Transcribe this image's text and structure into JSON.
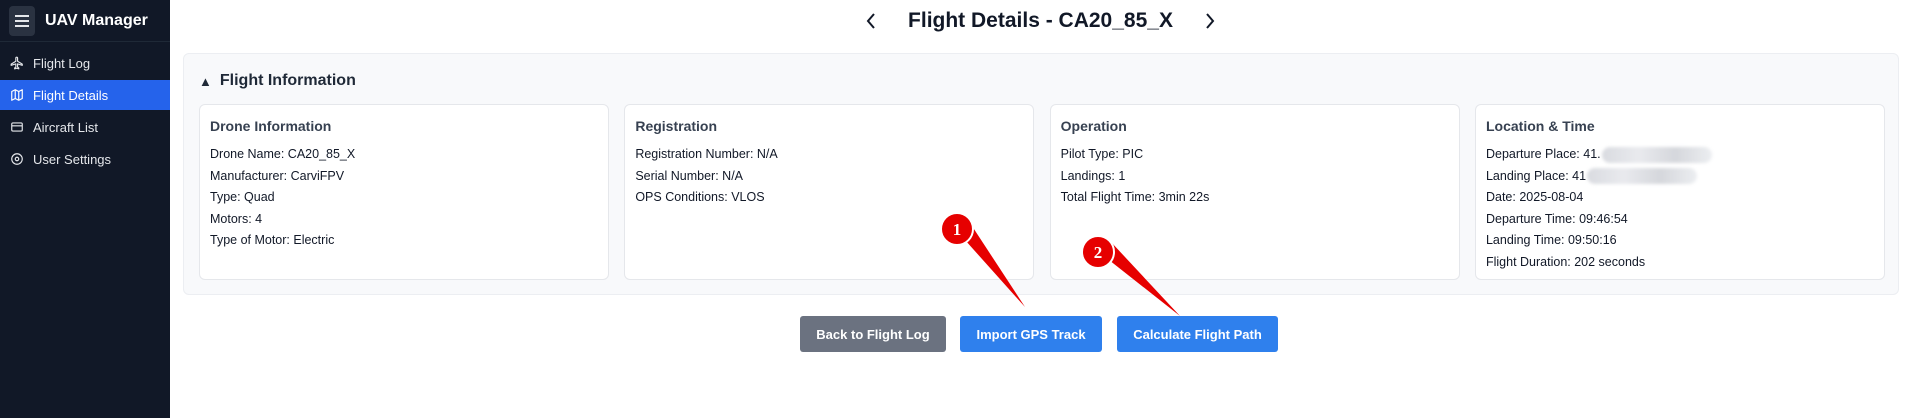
{
  "app": {
    "title": "UAV Manager"
  },
  "sidebar": {
    "items": [
      {
        "label": "Flight Log",
        "icon": "airplane-icon",
        "active": false
      },
      {
        "label": "Flight Details",
        "icon": "map-icon",
        "active": true
      },
      {
        "label": "Aircraft List",
        "icon": "list-icon",
        "active": false
      },
      {
        "label": "User Settings",
        "icon": "gear-icon",
        "active": false
      }
    ]
  },
  "header": {
    "title": "Flight Details - CA20_85_X",
    "prev_icon": "chevron-left-icon",
    "next_icon": "chevron-right-icon"
  },
  "section": {
    "label": "Flight Information",
    "toggle_glyph": "▲",
    "cards": {
      "drone": {
        "title": "Drone Information",
        "fields": [
          "Drone Name: CA20_85_X",
          "Manufacturer: CarviFPV",
          "Type: Quad",
          "Motors: 4",
          "Type of Motor: Electric"
        ]
      },
      "registration": {
        "title": "Registration",
        "fields": [
          "Registration Number: N/A",
          "Serial Number: N/A",
          "OPS Conditions: VLOS"
        ]
      },
      "operation": {
        "title": "Operation",
        "fields": [
          "Pilot Type: PIC",
          "Landings: 1",
          "Total Flight Time: 3min 22s"
        ]
      },
      "location": {
        "title": "Location & Time",
        "departure_place": "Departure Place: 41.",
        "landing_place": "Landing Place: 41",
        "date": "Date: 2025-08-04",
        "departure_time": "Departure Time: 09:46:54",
        "landing_time": "Landing Time: 09:50:16",
        "duration": "Flight Duration: 202 seconds"
      }
    }
  },
  "buttons": {
    "back": "Back to Flight Log",
    "import": "Import GPS Track",
    "calculate": "Calculate Flight Path"
  },
  "annotations": {
    "badge1": "1",
    "badge2": "2",
    "color": "#e60000"
  }
}
